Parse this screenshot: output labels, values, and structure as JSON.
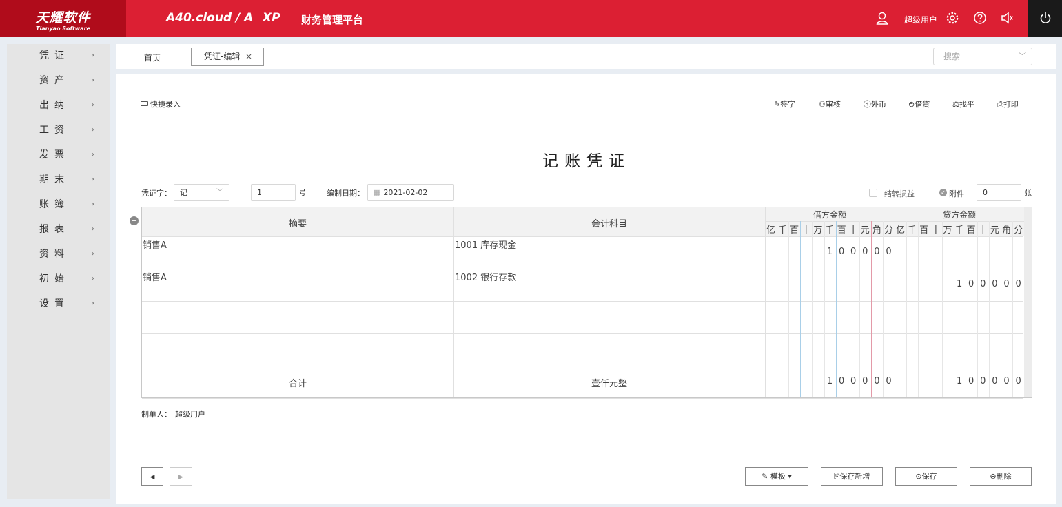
{
  "topbar": {
    "logo_main": "天耀软件",
    "logo_sub": "Tianyao Software",
    "product": "A40.cloud / A",
    "edition": "XP",
    "platform": "财务管理平台",
    "user_label": "超级用户",
    "icons": [
      "user-icon",
      "gear-icon",
      "help-icon",
      "speaker-icon",
      "power-icon"
    ]
  },
  "sidebar": {
    "items": [
      {
        "label": "凭证"
      },
      {
        "label": "资产"
      },
      {
        "label": "出纳"
      },
      {
        "label": "工资"
      },
      {
        "label": "发票"
      },
      {
        "label": "期末"
      },
      {
        "label": "账簿"
      },
      {
        "label": "报表"
      },
      {
        "label": "资料"
      },
      {
        "label": "初始"
      },
      {
        "label": "设置"
      }
    ]
  },
  "tabs": {
    "home": "首页",
    "active": "凭证-编辑",
    "close": "×",
    "search_placeholder": "搜索"
  },
  "toolbar": {
    "quick_entry": "快捷录入",
    "sign": "签字",
    "audit": "审核",
    "foreign": "外币",
    "debit_credit": "借贷",
    "balance": "找平",
    "print": "打印"
  },
  "voucher": {
    "title": "记账凭证",
    "word_label": "凭证字：",
    "word_value": "记",
    "number_value": "1",
    "number_suffix": "号",
    "date_label": "编制日期：",
    "date_value": "2021-02-02",
    "carry_label": "结转损益",
    "attach_label": "附件",
    "attach_value": "0",
    "attach_suffix": "张",
    "col_summary": "摘要",
    "col_account": "会计科目",
    "col_debit": "借方金额",
    "col_credit": "贷方金额",
    "units": [
      "亿",
      "千",
      "百",
      "十",
      "万",
      "千",
      "百",
      "十",
      "元",
      "角",
      "分"
    ],
    "rows": [
      {
        "summary": "销售A",
        "account": "1001 库存现金",
        "debit": "100000",
        "credit": ""
      },
      {
        "summary": "销售A",
        "account": "1002 银行存款",
        "debit": "",
        "credit": "100000"
      },
      {
        "summary": "",
        "account": "",
        "debit": "",
        "credit": ""
      },
      {
        "summary": "",
        "account": "",
        "debit": "",
        "credit": ""
      }
    ],
    "total_label": "合计",
    "total_words": "壹仟元整",
    "total_debit": "100000",
    "total_credit": "100000",
    "maker_label": "制单人：",
    "maker_value": "超级用户"
  },
  "buttons": {
    "prev": "◀",
    "next": "▶",
    "template": "模板",
    "save_new": "保存新增",
    "save": "保存",
    "delete": "删除"
  }
}
